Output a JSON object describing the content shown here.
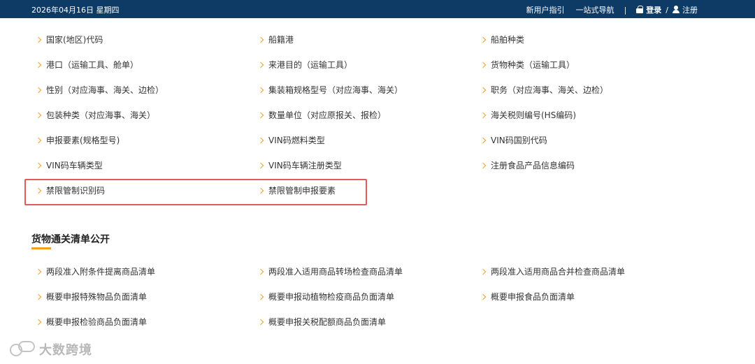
{
  "topbar": {
    "date": "2026年04月16日 星期四",
    "guide": "新用户指引",
    "nav": "一站式导航",
    "separator": "|",
    "login": "登录",
    "slash": "/",
    "register": "注册",
    "icons": {
      "login": "lock-icon",
      "register": "user-icon"
    }
  },
  "codes": {
    "items": [
      "国家(地区)代码",
      "船籍港",
      "船舶种类",
      "港口（运输工具、舱单）",
      "来港目的（运输工具）",
      "货物种类（运输工具）",
      "性别（对应海事、海关、边检）",
      "集装箱规格型号（对应海事、海关）",
      "职务（对应海事、海关、边检）",
      "包装种类（对应海事、海关）",
      "数量单位（对应原报关、报检）",
      "海关税则编号(HS编码)",
      "申报要素(规格型号)",
      "VIN码燃料类型",
      "VIN码国别代码",
      "VIN码车辆类型",
      "VIN码车辆注册类型",
      "注册食品产品信息编码",
      "禁限管制识别码",
      "禁限管制申报要素"
    ]
  },
  "clearance": {
    "title": "货物通关清单公开",
    "items": [
      "两段准入附条件提离商品清单",
      "两段准入适用商品转场检查商品清单",
      "两段准入适用商品合并检查商品清单",
      "概要申报特殊物品负面清单",
      "概要申报动植物检疫商品负面清单",
      "概要申报食品负面清单",
      "概要申报检验商品负面清单",
      "概要申报关税配额商品负面清单"
    ]
  },
  "watermark": {
    "text": "大数跨境"
  },
  "colors": {
    "topbar": "#0e3a66",
    "accent": "#f0a020",
    "highlight": "#e45a5a"
  }
}
